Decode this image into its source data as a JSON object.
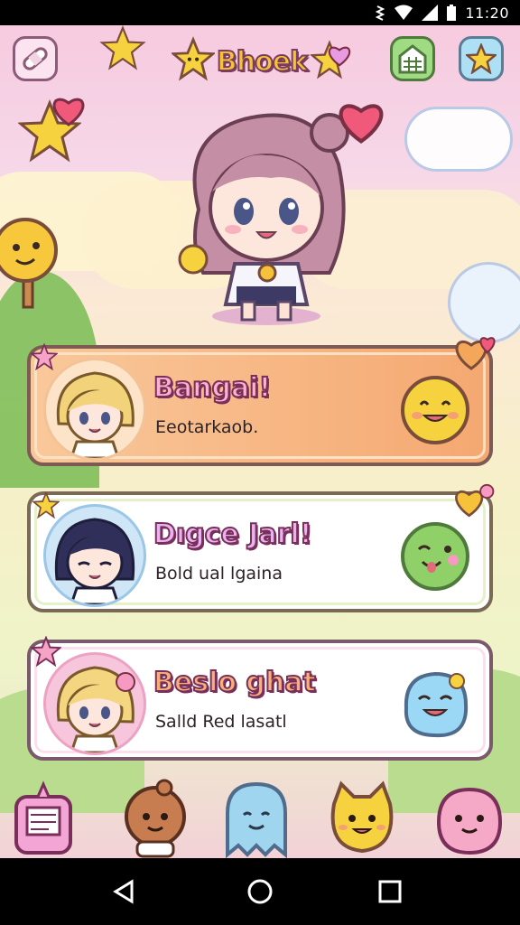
{
  "status_bar": {
    "time": "11:20",
    "icons": [
      "vibrate-icon",
      "wifi-icon",
      "signal-icon",
      "battery-icon"
    ]
  },
  "header": {
    "title": "Bhoek",
    "left_button_icon": "bandage-icon",
    "right_buttons": [
      "calendar-icon",
      "star-icon"
    ]
  },
  "cards": [
    {
      "title": "Bangai!",
      "subtitle": "Eeotarkaob.",
      "mood_icon": "happy-face-icon",
      "badge_icon": "heart-icon",
      "bg": "#f7b683",
      "mood_color": "#f6d23e"
    },
    {
      "title": "Dıgce Jarl!",
      "subtitle": "Bold ual lgaina",
      "mood_icon": "winking-face-icon",
      "badge_icon": "heart-icon",
      "bg": "#ffffff",
      "mood_color": "#8fd069"
    },
    {
      "title": "Beslo ghat",
      "subtitle": "Salld Red lasatl",
      "mood_icon": "laughing-face-icon",
      "badge_icon": "star-icon",
      "bg": "#ffffff",
      "mood_color": "#9bd8f6"
    }
  ],
  "bottom_nav": [
    "notebook-icon",
    "bear-icon",
    "ghost-icon",
    "cat-icon",
    "bunny-icon"
  ],
  "system_nav": [
    "back-icon",
    "home-icon",
    "recents-icon"
  ],
  "colors": {
    "accent_pink": "#f5a4c7",
    "outline": "#7d5a52",
    "title_yellow": "#f6c23a"
  }
}
